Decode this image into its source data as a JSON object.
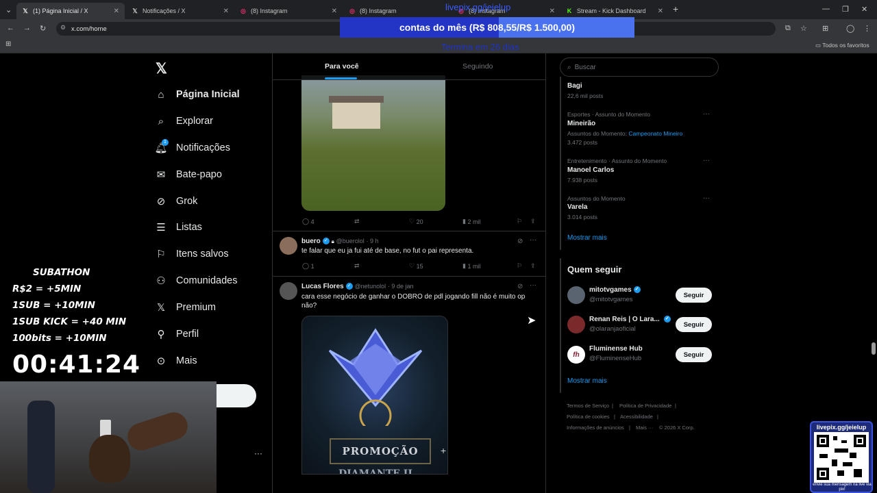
{
  "browser": {
    "tabs": [
      {
        "title": "(1) Página Inicial / X",
        "favicon": "x-logo",
        "active": true
      },
      {
        "title": "Notificações / X",
        "favicon": "x-logo"
      },
      {
        "title": "(8) Instagram",
        "favicon": "instagram-logo"
      },
      {
        "title": "(8) Instagram",
        "favicon": "instagram-logo"
      },
      {
        "title": "(8) Instagram",
        "favicon": "instagram-logo"
      },
      {
        "title": "Stream - Kick Dashboard",
        "favicon": "kick-logo"
      }
    ],
    "new_tab": "+",
    "url": "x.com/home",
    "bookmarks_label": "Todos os favoritos"
  },
  "overlay": {
    "livepix_top": "livepix.gg/jeielup",
    "donation_text": "contas do mês (R$ 808,55/R$ 1.500,00)",
    "donation_progress": 0.539,
    "deadline": "Termina em 26 dias",
    "subathon": [
      "SUBATHON",
      "R$2 = +5MIN",
      "1SUB  =  +10MIN",
      "1SUB KICK = +40 MIN",
      "100bits = +10MIN"
    ],
    "timer": "00:41:24",
    "qr_title": "livepix.gg/jeielup",
    "qr_caption": "envie sua mensagem na live via pix!"
  },
  "nav": {
    "items": [
      {
        "label": "Página Inicial",
        "icon": "home-icon"
      },
      {
        "label": "Explorar",
        "icon": "search-icon"
      },
      {
        "label": "Notificações",
        "icon": "bell-icon",
        "badge": "1"
      },
      {
        "label": "Bate-papo",
        "icon": "envelope-icon"
      },
      {
        "label": "Grok",
        "icon": "grok-icon"
      },
      {
        "label": "Listas",
        "icon": "list-icon"
      },
      {
        "label": "Itens salvos",
        "icon": "bookmark-icon"
      },
      {
        "label": "Comunidades",
        "icon": "people-icon"
      },
      {
        "label": "Premium",
        "icon": "x-logo-icon"
      },
      {
        "label": "Perfil",
        "icon": "person-icon"
      },
      {
        "label": "Mais",
        "icon": "more-circle-icon"
      }
    ],
    "more_dots": "···"
  },
  "feed": {
    "tabs": [
      "Para você",
      "Seguindo"
    ],
    "post1_actions": {
      "replies": "4",
      "retweets": "",
      "likes": "20",
      "views": "2 mil"
    },
    "post2": {
      "name": "buero",
      "handle": "@buerolol",
      "time": "· 9 h",
      "text": "te falar que eu ja fui até de base, no fut o pai representa.",
      "replies": "1",
      "likes": "15",
      "views": "1 mil"
    },
    "post3": {
      "name": "Lucas Flores",
      "handle": "@netunolol",
      "time": "· 9 de jan",
      "text": "cara esse negócio de ganhar o DOBRO de pdl jogando fill não é muito op não?",
      "image_text": "PROMOÇÃO",
      "image_subtext": "DIAMANTE II"
    }
  },
  "sidebar": {
    "search_placeholder": "Buscar",
    "trends": [
      {
        "category": "",
        "name": "Bagi",
        "count": "22,6 mil posts"
      },
      {
        "category": "Esportes · Assunto do Momento",
        "name": "Mineirão",
        "extra_label": "Assuntos do Momento:",
        "extra_link": "Campeonato Mineiro",
        "count": "3.472 posts"
      },
      {
        "category": "Entretenimento · Assunto do Momento",
        "name": "Manoel Carlos",
        "count": "7.938 posts"
      },
      {
        "category": "Assuntos do Momento",
        "name": "Varela",
        "count": "3.014 posts"
      }
    ],
    "show_more": "Mostrar mais",
    "who_to_follow_title": "Quem seguir",
    "who_to_follow": [
      {
        "name": "mitotvgames",
        "handle": "@mitotvgames",
        "button": "Seguir"
      },
      {
        "name": "Renan Reis | O Lara...",
        "handle": "@olaranjaoficial",
        "button": "Seguir"
      },
      {
        "name": "Fluminense Hub",
        "handle": "@FluminenseHub",
        "button": "Seguir"
      }
    ],
    "show_more_2": "Mostrar mais",
    "footer": [
      "Termos de Serviço",
      "Política de Privacidade",
      "Política de cookies",
      "Acessibilidade",
      "Informações de anúncios",
      "Mais ···",
      "© 2026 X Corp."
    ]
  },
  "colors": {
    "accent": "#1d9bf0",
    "donation_bar": "#2b3bd1",
    "background": "#000000"
  }
}
